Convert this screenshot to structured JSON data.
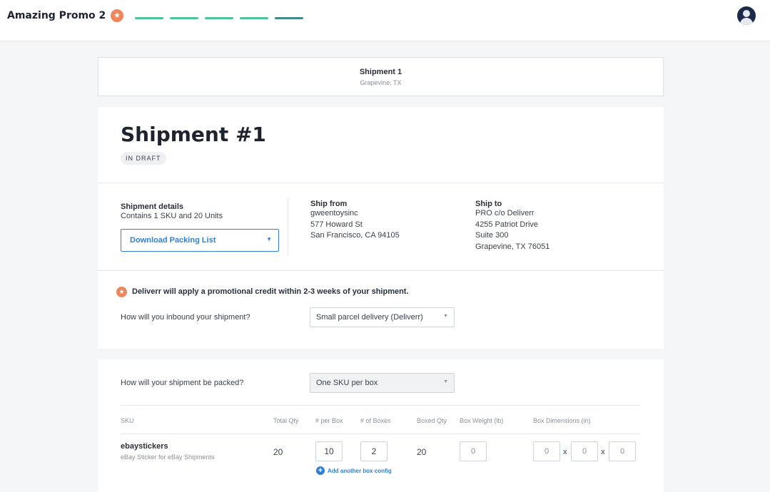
{
  "header": {
    "app_title": "Amazing Promo 2",
    "promo_icon": "star-badge-icon",
    "progress_steps": [
      {
        "state": "complete",
        "color": "#4ec396"
      },
      {
        "state": "complete",
        "color": "#4ec396"
      },
      {
        "state": "complete",
        "color": "#4ec396"
      },
      {
        "state": "complete",
        "color": "#4ec396"
      },
      {
        "state": "current",
        "color": "#3f8a8c"
      }
    ],
    "avatar_icon": "user-avatar-icon"
  },
  "shipment_tab": {
    "title": "Shipment 1",
    "location": "Grapevine, TX"
  },
  "shipment": {
    "title": "Shipment #1",
    "status": "IN DRAFT",
    "details": {
      "label": "Shipment details",
      "summary": "Contains 1 SKU and 20 Units",
      "download_button": "Download Packing List"
    },
    "ship_from": {
      "label": "Ship from",
      "lines": [
        "gweentoysinc",
        "577 Howard St",
        "San Francisco, CA 94105"
      ]
    },
    "ship_to": {
      "label": "Ship to",
      "lines": [
        "PRO c/o Deliverr",
        "4255 Patriot Drive",
        "Suite 300",
        "Grapevine, TX 76051"
      ]
    },
    "promo_message": "Deliverr will apply a promotional credit within 2-3 weeks of your shipment.",
    "inbound_question": "How will you inbound your shipment?",
    "inbound_selected": "Small parcel delivery (Deliverr)"
  },
  "packing": {
    "question": "How will your shipment be packed?",
    "selected": "One SKU per box",
    "columns": [
      "SKU",
      "Total Qty",
      "# per Box",
      "# of Boxes",
      "Boxed Qty",
      "Box Weight (lb)",
      "Box Dimensions (in)"
    ],
    "rows": [
      {
        "sku": "ebaystickers",
        "description": "eBay Sticker for eBay Shipments",
        "total_qty": "20",
        "per_box": "10",
        "num_boxes": "2",
        "boxed_qty": "20",
        "box_weight": "0",
        "dim_l": "0",
        "dim_w": "0",
        "dim_h": "0",
        "dim_separator": "x"
      }
    ],
    "add_config_label": "Add another box config"
  },
  "colors": {
    "accent_blue": "#2f7fd8",
    "promo_orange": "#f0855a",
    "progress_green": "#4ec396",
    "progress_current": "#3f8a8c"
  }
}
